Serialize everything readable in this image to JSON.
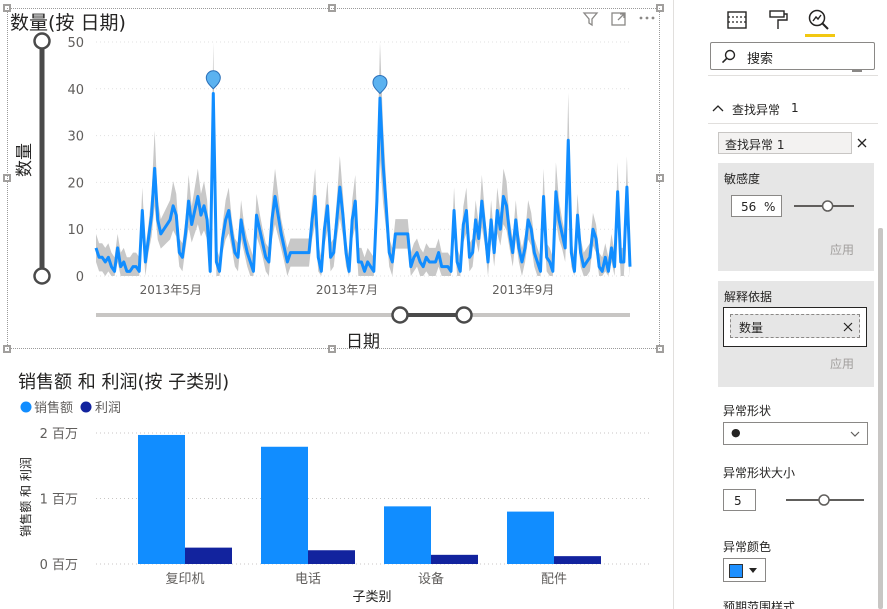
{
  "chart1": {
    "title": "数量(按 日期)",
    "ylabel": "数量",
    "xlabel": "日期",
    "y_ticks": [
      "50",
      "40",
      "30",
      "20",
      "10",
      "0"
    ],
    "x_ticks": [
      "2013年5月",
      "2013年7月",
      "2013年9月"
    ]
  },
  "chart2": {
    "title": "销售额 和 利润(按 子类别)",
    "legend": [
      "销售额",
      "利润"
    ],
    "ylabel": "销售额 和 利润",
    "xlabel": "子类别",
    "y_ticks": [
      "2 百万",
      "1 百万",
      "0 百万"
    ]
  },
  "chart_data": [
    {
      "type": "line",
      "title": "数量(按 日期)",
      "xlabel": "日期",
      "ylabel": "数量",
      "ylim": [
        0,
        50
      ],
      "x_tick_labels": [
        "2013年5月",
        "2013年7月",
        "2013年9月"
      ],
      "y": [
        6,
        4,
        4,
        3,
        4,
        2,
        1,
        6,
        2,
        3,
        1,
        1,
        2,
        2,
        1,
        14,
        3,
        8,
        13,
        23,
        12,
        9,
        10,
        11,
        12,
        15,
        13,
        5,
        4,
        9,
        16,
        11,
        14,
        17,
        13,
        15,
        12,
        1,
        39,
        3,
        1,
        8,
        12,
        14,
        9,
        5,
        4,
        12,
        8,
        5,
        3,
        1,
        13,
        10,
        7,
        4,
        3,
        12,
        17,
        13,
        9,
        6,
        3,
        5,
        5,
        5,
        5,
        5,
        5,
        5,
        12,
        17,
        4,
        1,
        10,
        15,
        4,
        5,
        12,
        19,
        13,
        5,
        1,
        12,
        16,
        3,
        3,
        1,
        3,
        2,
        1,
        16,
        38,
        24,
        15,
        5,
        3,
        9,
        9,
        9,
        9,
        9,
        2,
        4,
        5,
        3,
        2,
        4,
        3,
        3,
        3,
        5,
        2,
        2,
        2,
        1,
        14,
        3,
        1,
        11,
        14,
        4,
        5,
        12,
        8,
        16,
        10,
        3,
        12,
        5,
        14,
        10,
        17,
        15,
        9,
        5,
        12,
        6,
        3,
        6,
        12,
        10,
        5,
        3,
        1,
        17,
        4,
        3,
        1,
        18,
        12,
        9,
        6,
        29,
        5,
        1,
        13,
        5,
        2,
        3,
        4,
        10,
        8,
        2,
        1,
        4,
        1,
        6,
        2,
        18,
        3,
        3,
        19,
        2
      ],
      "anomalies": [
        {
          "index": 38,
          "value": 40
        },
        {
          "index": 92,
          "value": 39
        }
      ]
    },
    {
      "type": "bar",
      "title": "销售额 和 利润(按 子类别)",
      "xlabel": "子类别",
      "ylabel": "销售额 和 利润",
      "ylim": [
        0,
        2
      ],
      "categories": [
        "复印机",
        "电话",
        "设备",
        "配件"
      ],
      "series": [
        {
          "name": "销售额",
          "values": [
            1.97,
            1.79,
            0.88,
            0.8
          ],
          "color": "#118DFF"
        },
        {
          "name": "利润",
          "values": [
            0.25,
            0.21,
            0.14,
            0.12
          ],
          "color": "#12239E"
        }
      ]
    }
  ],
  "pane": {
    "search_placeholder": "搜索",
    "section_header": "查找异常",
    "section_count": "1",
    "item_name": "查找异常 1",
    "sensitivity_label": "敏感度",
    "sensitivity_value": "56",
    "sensitivity_unit": "%",
    "sensitivity_level": 0.56,
    "apply_label": "应用",
    "explain_label": "解释依据",
    "explain_field": "数量",
    "apply_label2": "应用",
    "shape_label": "异常形状",
    "shape_value": "●",
    "shape_size_label": "异常形状大小",
    "shape_size_value": "5",
    "color_label": "异常颜色",
    "anomaly_color": "#1E90FF",
    "truncated_label": "预期范围样式"
  },
  "colors": {
    "line": "#118DFF",
    "band": "#C8C8C8",
    "anomaly": "#5BB2F0",
    "accent": "#F2C811"
  }
}
